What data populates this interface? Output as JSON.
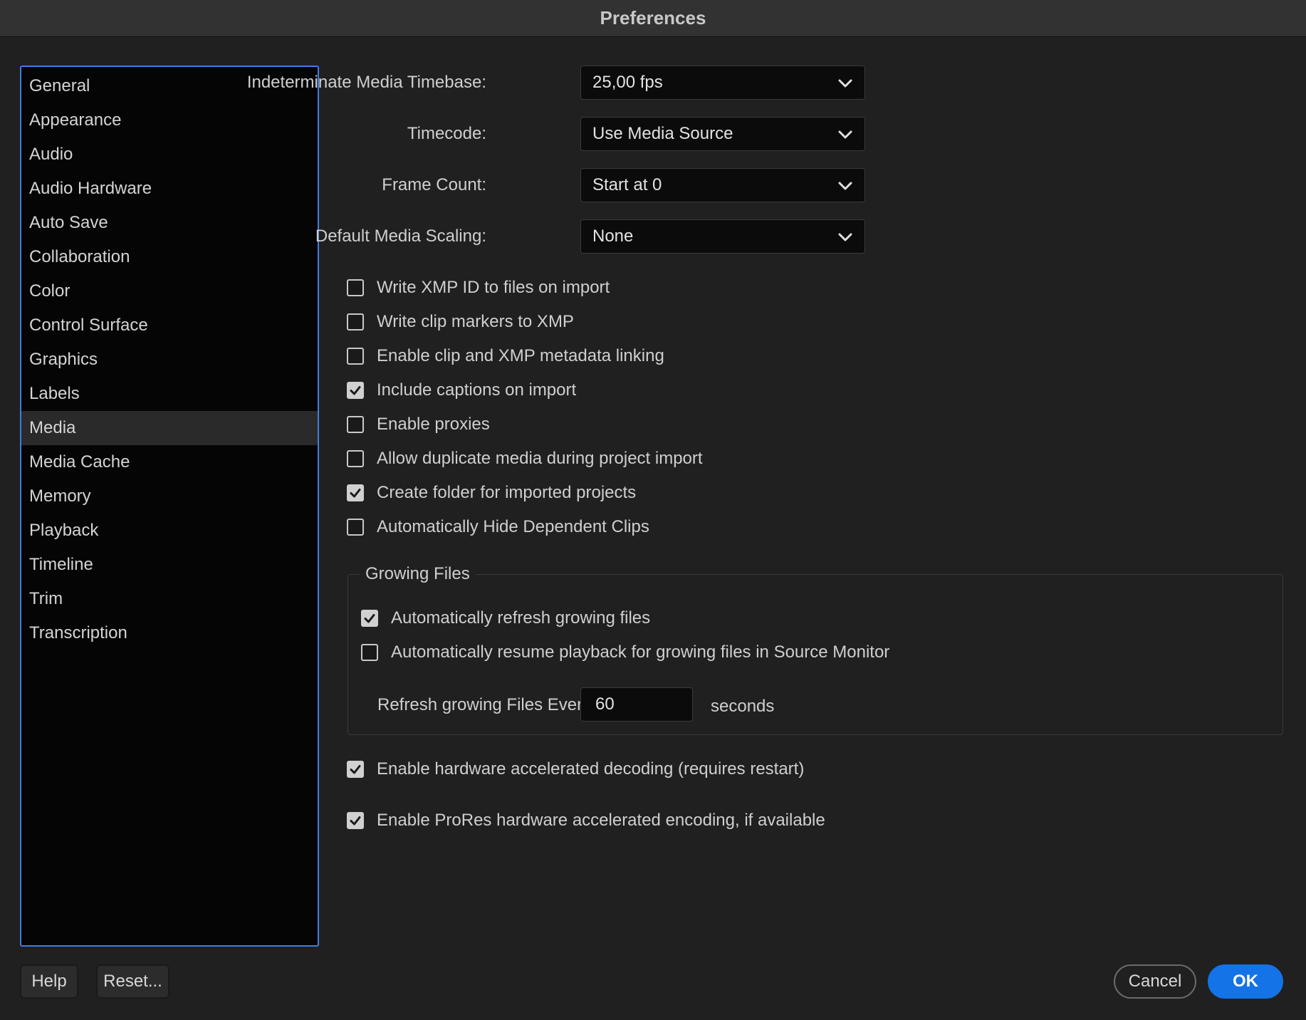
{
  "window": {
    "title": "Preferences"
  },
  "sidebar": {
    "items": [
      {
        "label": "General"
      },
      {
        "label": "Appearance"
      },
      {
        "label": "Audio"
      },
      {
        "label": "Audio Hardware"
      },
      {
        "label": "Auto Save"
      },
      {
        "label": "Collaboration"
      },
      {
        "label": "Color"
      },
      {
        "label": "Control Surface"
      },
      {
        "label": "Graphics"
      },
      {
        "label": "Labels"
      },
      {
        "label": "Media",
        "selected": true
      },
      {
        "label": "Media Cache"
      },
      {
        "label": "Memory"
      },
      {
        "label": "Playback"
      },
      {
        "label": "Timeline"
      },
      {
        "label": "Trim"
      },
      {
        "label": "Transcription"
      }
    ]
  },
  "settings": {
    "timebase": {
      "label": "Indeterminate Media Timebase:",
      "value": "25,00 fps"
    },
    "timecode": {
      "label": "Timecode:",
      "value": "Use Media Source"
    },
    "frame_count": {
      "label": "Frame Count:",
      "value": "Start at 0"
    },
    "scaling": {
      "label": "Default Media Scaling:",
      "value": "None"
    }
  },
  "checkboxes": {
    "write_xmp_id": {
      "label": "Write XMP ID to files on import",
      "checked": false
    },
    "write_clip_markers": {
      "label": "Write clip markers to XMP",
      "checked": false
    },
    "enable_xmp_linking": {
      "label": "Enable clip and XMP metadata linking",
      "checked": false
    },
    "include_captions": {
      "label": "Include captions on import",
      "checked": true
    },
    "enable_proxies": {
      "label": "Enable proxies",
      "checked": false
    },
    "allow_duplicate": {
      "label": "Allow duplicate media during project import",
      "checked": false
    },
    "create_folder": {
      "label": "Create folder for imported projects",
      "checked": true
    },
    "hide_dependent": {
      "label": "Automatically Hide Dependent Clips",
      "checked": false
    },
    "auto_refresh": {
      "label": "Automatically refresh growing files",
      "checked": true
    },
    "auto_resume": {
      "label": "Automatically resume playback for growing files in Source Monitor",
      "checked": false
    },
    "hw_decoding": {
      "label": "Enable hardware accelerated decoding (requires restart)",
      "checked": true
    },
    "prores_encoding": {
      "label": "Enable ProRes hardware accelerated encoding, if available",
      "checked": true
    }
  },
  "growing_files": {
    "title": "Growing Files",
    "refresh_label": "Refresh growing Files Every",
    "refresh_value": "60",
    "unit": "seconds"
  },
  "buttons": {
    "help": "Help",
    "reset": "Reset...",
    "cancel": "Cancel",
    "ok": "OK"
  }
}
